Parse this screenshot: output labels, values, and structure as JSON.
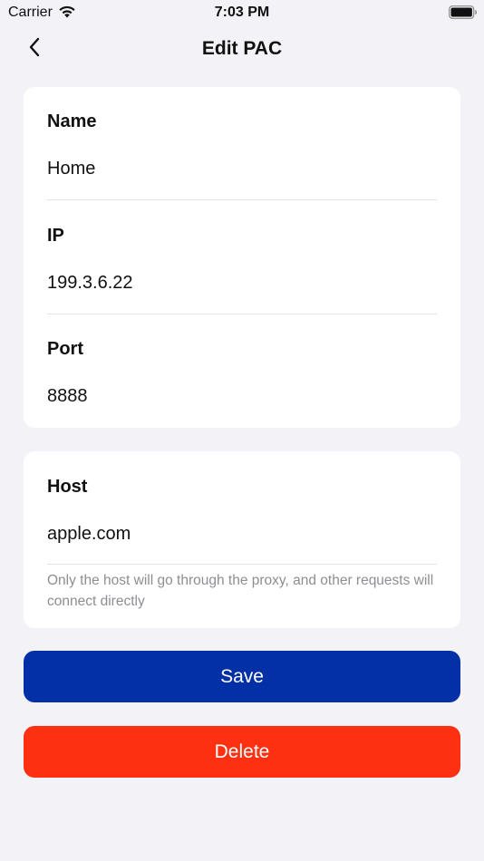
{
  "status_bar": {
    "carrier": "Carrier",
    "time": "7:03 PM",
    "wifi_icon": "wifi-icon",
    "battery_icon": "battery-icon"
  },
  "nav": {
    "back_icon": "chevron-left-icon",
    "title": "Edit PAC"
  },
  "proxy_card": {
    "name_label": "Name",
    "name_value": "Home",
    "ip_label": "IP",
    "ip_value": "199.3.6.22",
    "port_label": "Port",
    "port_value": "8888"
  },
  "host_card": {
    "host_label": "Host",
    "host_value": "apple.com",
    "help_text": "Only the host will go through the proxy, and other requests will connect directly"
  },
  "actions": {
    "save_label": "Save",
    "delete_label": "Delete"
  },
  "colors": {
    "background": "#f2f2f7",
    "card": "#ffffff",
    "save": "#0330a6",
    "delete": "#fd3011",
    "help_text": "#8e8e93"
  }
}
